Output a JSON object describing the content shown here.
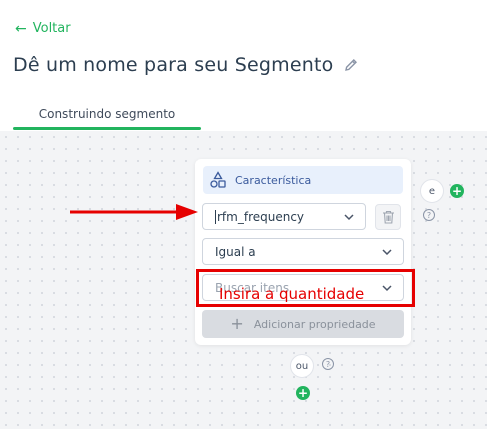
{
  "header": {
    "back_label": "Voltar",
    "title": "Dê um nome para seu Segmento"
  },
  "tabs": [
    {
      "label": "Construindo segmento",
      "active": true
    }
  ],
  "card": {
    "header_label": "Característica",
    "property_select": {
      "value": "rfm_frequency"
    },
    "operator_select": {
      "value": "Igual a"
    },
    "value_select": {
      "placeholder": "Buscar itens"
    },
    "add_property_label": "Adicionar propriedade"
  },
  "connectors": {
    "and_label": "e",
    "or_label": "ou"
  },
  "annotations": {
    "instruction_text": "Insira a quantidade"
  },
  "colors": {
    "accent_green": "#22b45e",
    "annotation_red": "#e60000",
    "header_blue_bg": "#e8f0fc"
  },
  "icons": {
    "back": "arrow-left-icon",
    "edit": "pencil-icon",
    "characteristic": "shapes-icon",
    "delete": "trash-icon",
    "dropdown": "chevron-down-icon",
    "add": "plus-icon",
    "help": "question-circle-icon"
  }
}
